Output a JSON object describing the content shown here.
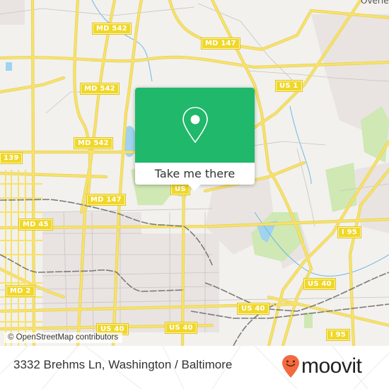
{
  "map": {
    "route_shields": [
      {
        "id": "md542-a",
        "label": "MD 542"
      },
      {
        "id": "md542-b",
        "label": "MD 542"
      },
      {
        "id": "md542-c",
        "label": "MD 542"
      },
      {
        "id": "md147-a",
        "label": "MD 147"
      },
      {
        "id": "md147-b",
        "label": "MD 147"
      },
      {
        "id": "us1",
        "label": "US 1"
      },
      {
        "id": "md139",
        "label": "139"
      },
      {
        "id": "md45",
        "label": "MD 45"
      },
      {
        "id": "md2",
        "label": "MD 2"
      },
      {
        "id": "i95-a",
        "label": "I 95"
      },
      {
        "id": "i95-b",
        "label": "I 95"
      },
      {
        "id": "us40-a",
        "label": "US 40"
      },
      {
        "id": "us40-b",
        "label": "US 40"
      },
      {
        "id": "us40-c",
        "label": "US 40"
      },
      {
        "id": "us40-d",
        "label": "US 40"
      },
      {
        "id": "us-partial",
        "label": "US"
      }
    ],
    "place_label": "Overlea",
    "attribution": "© OpenStreetMap contributors",
    "colors": {
      "road": "#f7e26b",
      "water": "#9fd3ee",
      "park": "#cfe8b4",
      "rail": "#777777",
      "land": "#f2f1ee",
      "urban": "#e9e4e2"
    }
  },
  "popup": {
    "icon": "location-pin-icon",
    "button_label": "Take me there",
    "color": "#20b86a"
  },
  "footer": {
    "address": "3332 Brehms Ln, Washington / Baltimore",
    "brand": "moovit",
    "brand_color": "#f26a3f"
  }
}
